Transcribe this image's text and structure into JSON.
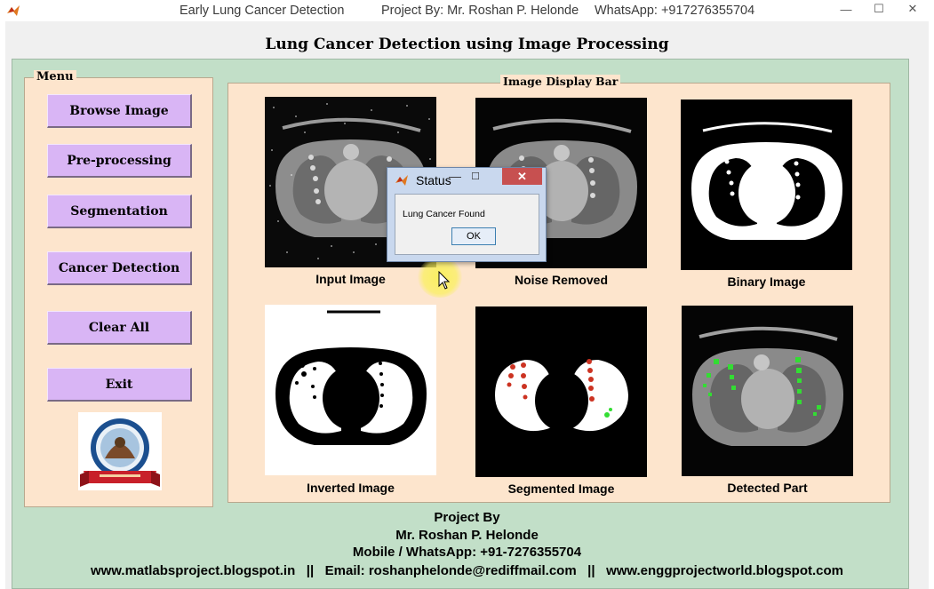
{
  "window": {
    "title": "Early Lung Cancer Detection",
    "project_by": "Project By: Mr. Roshan P. Helonde",
    "whatsapp": "WhatsApp: +917276355704",
    "controls": {
      "minimize": "—",
      "maximize": "☐",
      "close": "✕"
    }
  },
  "header": {
    "title": "Lung Cancer Detection using Image Processing"
  },
  "menu": {
    "legend": "Menu",
    "buttons": [
      {
        "label": "Browse Image"
      },
      {
        "label": "Pre-processing"
      },
      {
        "label": "Segmentation"
      },
      {
        "label": "Cancer Detection"
      },
      {
        "label": "Clear All"
      },
      {
        "label": "Exit"
      }
    ]
  },
  "display": {
    "legend": "Image Display Bar",
    "images": [
      {
        "caption": "Input Image"
      },
      {
        "caption": "Noise Removed"
      },
      {
        "caption": "Binary Image"
      },
      {
        "caption": "Inverted Image"
      },
      {
        "caption": "Segmented Image"
      },
      {
        "caption": "Detected Part"
      }
    ]
  },
  "footer": {
    "line1": "Project By",
    "line2": "Mr. Roshan P. Helonde",
    "line3": "Mobile / WhatsApp: +91-7276355704",
    "line4": "www.matlabsproject.blogspot.in   ||   Email: roshanphelonde@rediffmail.com   ||   www.enggprojectworld.blogspot.com"
  },
  "dialog": {
    "title": "Status",
    "message": "Lung Cancer Found",
    "ok_label": "OK",
    "close": "✕"
  },
  "colors": {
    "panel_green": "#c2dfc8",
    "panel_peach": "#fde5cd",
    "button_violet": "#d9b5f5",
    "close_red": "#c75050",
    "detected_green": "#33dd33",
    "segmented_red": "#cc3322"
  }
}
